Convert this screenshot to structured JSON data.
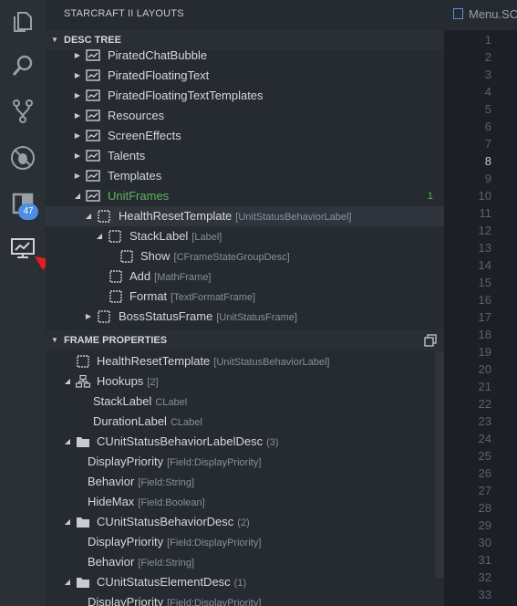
{
  "activity_bar": {
    "items": [
      {
        "name": "explorer",
        "icon": "files-icon"
      },
      {
        "name": "search",
        "icon": "search-icon"
      },
      {
        "name": "source-control",
        "icon": "source-control-icon"
      },
      {
        "name": "debug",
        "icon": "debug-icon"
      },
      {
        "name": "extensions",
        "icon": "extensions-icon",
        "badge": "47"
      },
      {
        "name": "sc2-layouts",
        "icon": "chart-monitor-icon"
      }
    ],
    "annotation_color": "#e02020"
  },
  "sidebar": {
    "title": "STARCRAFT II LAYOUTS",
    "desc_tree": {
      "header": "DESC TREE",
      "rows": [
        {
          "label": "PiratedChatBubble",
          "type": ""
        },
        {
          "label": "PiratedFloatingText",
          "type": ""
        },
        {
          "label": "PiratedFloatingTextTemplates",
          "type": ""
        },
        {
          "label": "Resources",
          "type": ""
        },
        {
          "label": "ScreenEffects",
          "type": ""
        },
        {
          "label": "Talents",
          "type": ""
        },
        {
          "label": "Templates",
          "type": ""
        },
        {
          "label": "UnitFrames",
          "type": "",
          "count": "1"
        },
        {
          "label": "HealthResetTemplate",
          "type": "[UnitStatusBehaviorLabel]"
        },
        {
          "label": "StackLabel",
          "type": "[Label]"
        },
        {
          "label": "Show",
          "type": "[CFrameStateGroupDesc]"
        },
        {
          "label": "Add",
          "type": "[MathFrame]"
        },
        {
          "label": "Format",
          "type": "[TextFormatFrame]"
        },
        {
          "label": "BossStatusFrame",
          "type": "[UnitStatusFrame]"
        }
      ]
    },
    "frame_properties": {
      "header": "FRAME PROPERTIES",
      "rows": [
        {
          "label": "HealthResetTemplate",
          "type": "[UnitStatusBehaviorLabel]"
        },
        {
          "label": "Hookups",
          "type": "[2]"
        },
        {
          "label": "StackLabel",
          "type": "CLabel"
        },
        {
          "label": "DurationLabel",
          "type": "CLabel"
        },
        {
          "label": "CUnitStatusBehaviorLabelDesc",
          "type": "(3)"
        },
        {
          "label": "DisplayPriority",
          "type": "[Field:DisplayPriority]"
        },
        {
          "label": "Behavior",
          "type": "[Field:String]"
        },
        {
          "label": "HideMax",
          "type": "[Field:Boolean]"
        },
        {
          "label": "CUnitStatusBehaviorDesc",
          "type": "(2)"
        },
        {
          "label": "DisplayPriority",
          "type": "[Field:DisplayPriority]"
        },
        {
          "label": "Behavior",
          "type": "[Field:String]"
        },
        {
          "label": "CUnitStatusElementDesc",
          "type": "(1)"
        },
        {
          "label": "DisplayPriority",
          "type": "[Field:DisplayPriority]"
        }
      ]
    }
  },
  "editor": {
    "tab_label": "Menu.SC",
    "line_numbers": [
      "1",
      "2",
      "3",
      "4",
      "5",
      "6",
      "7",
      "8",
      "9",
      "10",
      "11",
      "12",
      "13",
      "14",
      "15",
      "16",
      "17",
      "18",
      "19",
      "20",
      "21",
      "22",
      "23",
      "24",
      "25",
      "26",
      "27",
      "28",
      "29",
      "30",
      "31",
      "32",
      "33"
    ],
    "current_line": "8"
  }
}
